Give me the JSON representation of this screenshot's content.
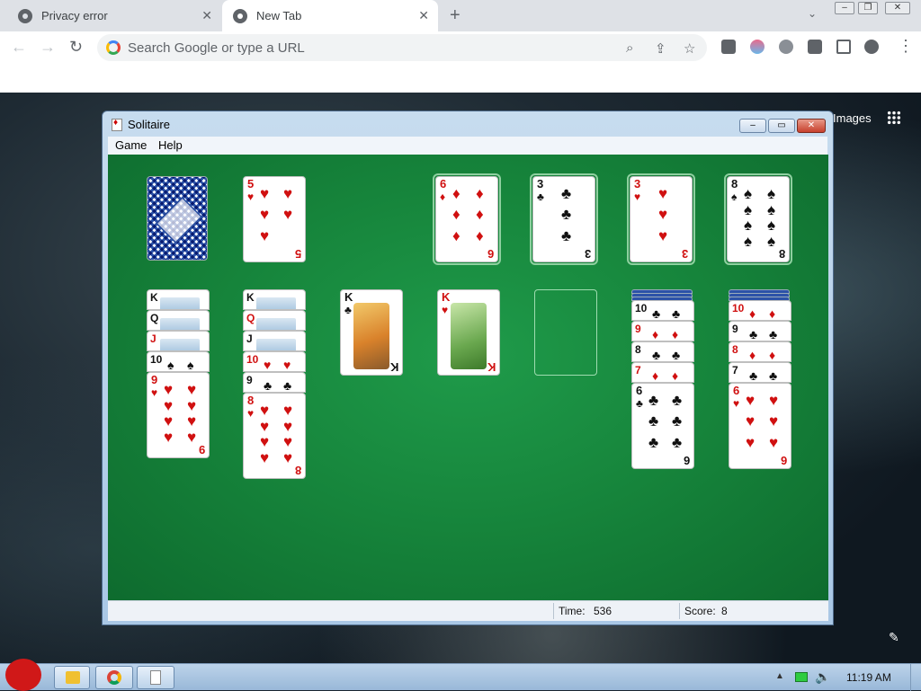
{
  "browser": {
    "tabs": [
      {
        "label": "Privacy error",
        "active": false
      },
      {
        "label": "New Tab",
        "active": true
      }
    ],
    "newtab_icon": "+",
    "omnibox_placeholder": "Search Google or type a URL"
  },
  "ntp": {
    "images_link": "Images"
  },
  "solitaire": {
    "title": "Solitaire",
    "menus": [
      "Game",
      "Help"
    ],
    "time_label": "Time:",
    "time_value": "536",
    "score_label": "Score:",
    "score_value": "8",
    "stock_waste": {
      "waste_top": {
        "rank": "5",
        "suit": "♥",
        "color": "red"
      }
    },
    "foundations": [
      {
        "rank": "6",
        "suit": "♦",
        "color": "red"
      },
      {
        "rank": "3",
        "suit": "♣",
        "color": "black"
      },
      {
        "rank": "3",
        "suit": "♥",
        "color": "red"
      },
      {
        "rank": "8",
        "suit": "♠",
        "color": "black"
      }
    ],
    "tableau": [
      {
        "peeks": [
          [
            "K",
            "♠"
          ],
          [
            "Q",
            "♠"
          ],
          [
            "J",
            "♦"
          ],
          [
            "10",
            "♠"
          ]
        ],
        "top": {
          "rank": "9",
          "suit": "♥"
        }
      },
      {
        "peeks": [
          [
            "K",
            "♣"
          ],
          [
            "Q",
            "♦"
          ],
          [
            "J",
            "♣"
          ],
          [
            "10",
            "♥"
          ],
          [
            "9",
            "♣"
          ]
        ],
        "top": {
          "rank": "8",
          "suit": "♥"
        }
      },
      {
        "peeks": [],
        "top": {
          "rank": "K",
          "suit": "♣"
        }
      },
      {
        "peeks": [],
        "top": {
          "rank": "K",
          "suit": "♥"
        }
      },
      {
        "peeks": [],
        "top": null
      },
      {
        "peeks": [
          [
            "10",
            "♣"
          ],
          [
            "9",
            "♦"
          ],
          [
            "8",
            "♣"
          ],
          [
            "7",
            "♦"
          ]
        ],
        "top": {
          "rank": "6",
          "suit": "♣"
        }
      },
      {
        "peeks": [
          [
            "10",
            "♦"
          ],
          [
            "9",
            "♣"
          ],
          [
            "8",
            "♦"
          ],
          [
            "7",
            "♣"
          ]
        ],
        "top": {
          "rank": "6",
          "suit": "♥"
        }
      }
    ]
  },
  "taskbar": {
    "clock": "11:19 AM"
  }
}
